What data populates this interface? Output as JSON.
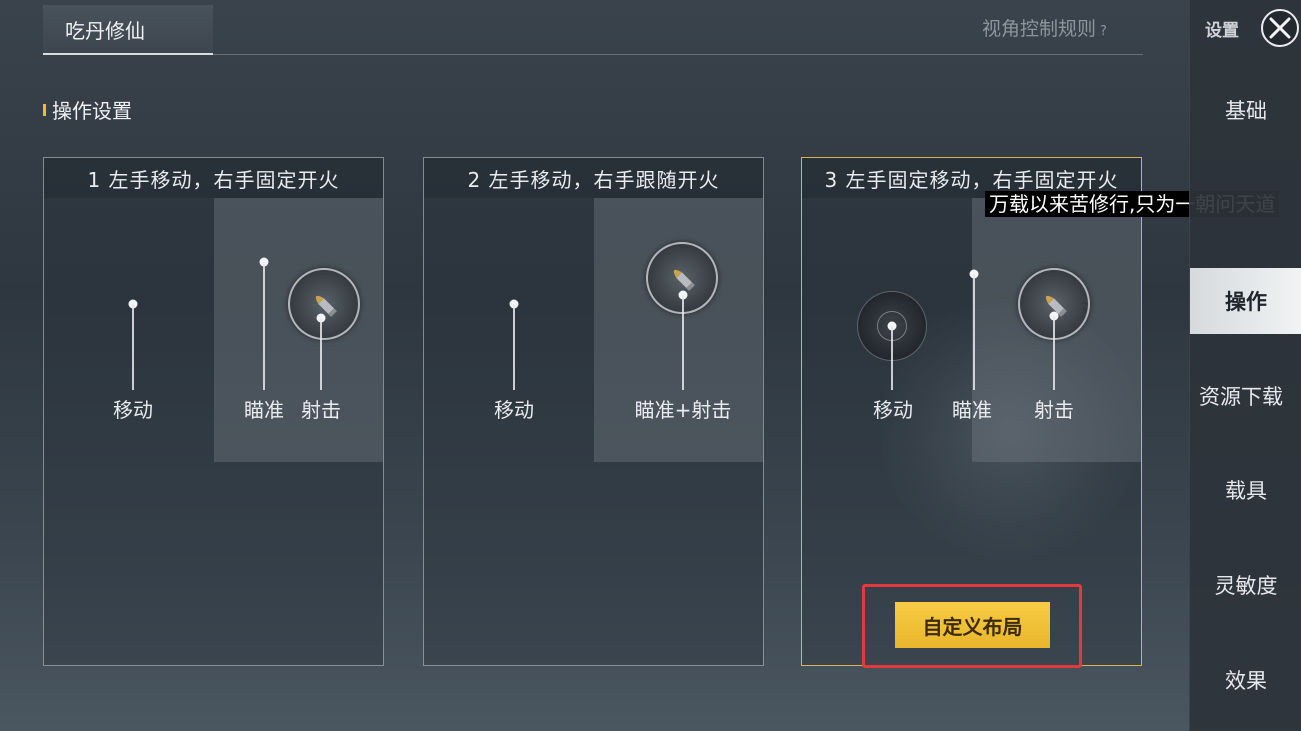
{
  "header": {
    "tab_label": "吃丹修仙",
    "rules_link": "视角控制规则",
    "rules_mark": "?"
  },
  "section": {
    "title": "操作设置"
  },
  "cards": [
    {
      "title": "1 左手移动，右手固定开火",
      "labels": {
        "move": "移动",
        "aim": "瞄准",
        "fire": "射击"
      }
    },
    {
      "title": "2 左手移动，右手跟随开火",
      "labels": {
        "move": "移动",
        "aim_fire": "瞄准+射击"
      }
    },
    {
      "title": "3 左手固定移动，右手固定开火",
      "labels": {
        "move": "移动",
        "aim": "瞄准",
        "fire": "射击"
      },
      "button": "自定义布局",
      "selected": true
    }
  ],
  "caption": "万载以来苦修行,只为一朝问天道",
  "sidebar": {
    "header_label": "设置",
    "items": [
      {
        "label": "基础"
      },
      {
        "label": "操作",
        "active": true
      },
      {
        "label": "资源下载"
      },
      {
        "label": "载具"
      },
      {
        "label": "灵敏度"
      },
      {
        "label": "效果"
      }
    ]
  },
  "colors": {
    "accent_gold": "#f2b83a",
    "button_yellow": "#f7cc44",
    "highlight_red": "#e23a3a",
    "selected_border": "#d6b254"
  }
}
